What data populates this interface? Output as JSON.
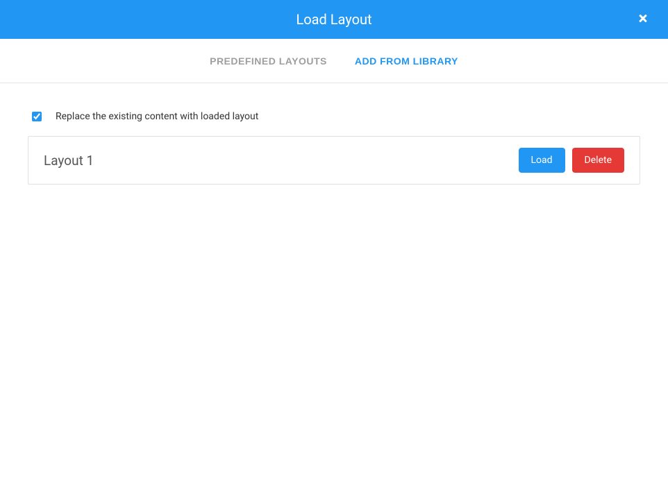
{
  "header": {
    "title": "Load Layout"
  },
  "tabs": [
    {
      "label": "Predefined Layouts",
      "active": false
    },
    {
      "label": "Add From Library",
      "active": true
    }
  ],
  "replace_checkbox": {
    "label": "Replace the existing content with loaded layout",
    "checked": true
  },
  "layouts": [
    {
      "name": "Layout 1",
      "load_label": "Load",
      "delete_label": "Delete"
    }
  ],
  "colors": {
    "primary": "#2196f3",
    "danger": "#e53935",
    "text_muted": "#9e9e9e"
  }
}
